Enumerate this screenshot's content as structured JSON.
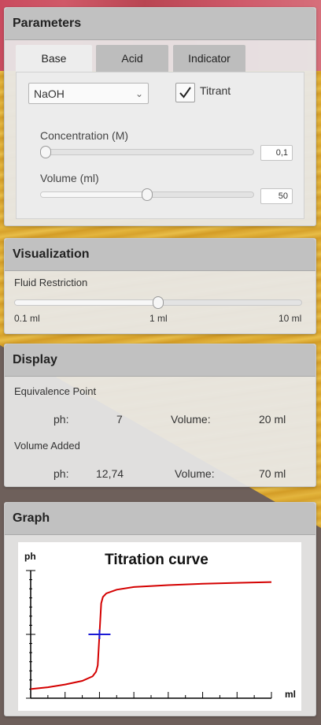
{
  "parameters": {
    "title": "Parameters",
    "tabs": [
      {
        "label": "Base",
        "active": true
      },
      {
        "label": "Acid",
        "active": false
      },
      {
        "label": "Indicator",
        "active": false
      }
    ],
    "substance": {
      "selected": "NaOH"
    },
    "titrant": {
      "label": "Titrant",
      "checked": true
    },
    "concentration": {
      "label": "Concentration (M)",
      "value": "0,1",
      "slider_fraction": 0.0
    },
    "volume": {
      "label": "Volume (ml)",
      "value": "50",
      "slider_fraction": 0.5
    }
  },
  "visualization": {
    "title": "Visualization",
    "fluid_restriction_label": "Fluid Restriction",
    "slider_fraction": 0.5,
    "ticks": {
      "min": "0.1 ml",
      "mid": "1 ml",
      "max": "10 ml"
    }
  },
  "display": {
    "title": "Display",
    "equivalence": {
      "heading": "Equivalence Point",
      "ph_label": "ph:",
      "ph_value": "7",
      "volume_label": "Volume:",
      "volume_value": "20 ml"
    },
    "added": {
      "heading": "Volume Added",
      "ph_label": "ph:",
      "ph_value": "12,74",
      "volume_label": "Volume:",
      "volume_value": "70 ml"
    }
  },
  "graph": {
    "title": "Graph",
    "chart_title": "Titration curve",
    "ylabel": "ph",
    "xlabel": "ml",
    "colors": {
      "curve": "#d40000",
      "marker": "#1a1ad6",
      "axis": "#000000"
    }
  },
  "chart_data": {
    "type": "line",
    "title": "Titration curve",
    "xlabel": "ml",
    "ylabel": "ph",
    "xlim": [
      0,
      70
    ],
    "ylim": [
      0,
      14
    ],
    "series": [
      {
        "x": [
          0,
          5,
          10,
          15,
          18,
          19,
          19.5,
          20,
          20.5,
          21,
          22,
          25,
          30,
          40,
          50,
          60,
          70
        ],
        "y": [
          1.0,
          1.2,
          1.5,
          1.9,
          2.4,
          2.9,
          3.6,
          7.0,
          10.4,
          11.1,
          11.5,
          11.9,
          12.2,
          12.4,
          12.55,
          12.65,
          12.74
        ]
      }
    ],
    "equivalence_marker": {
      "x": 20,
      "y": 7
    }
  }
}
